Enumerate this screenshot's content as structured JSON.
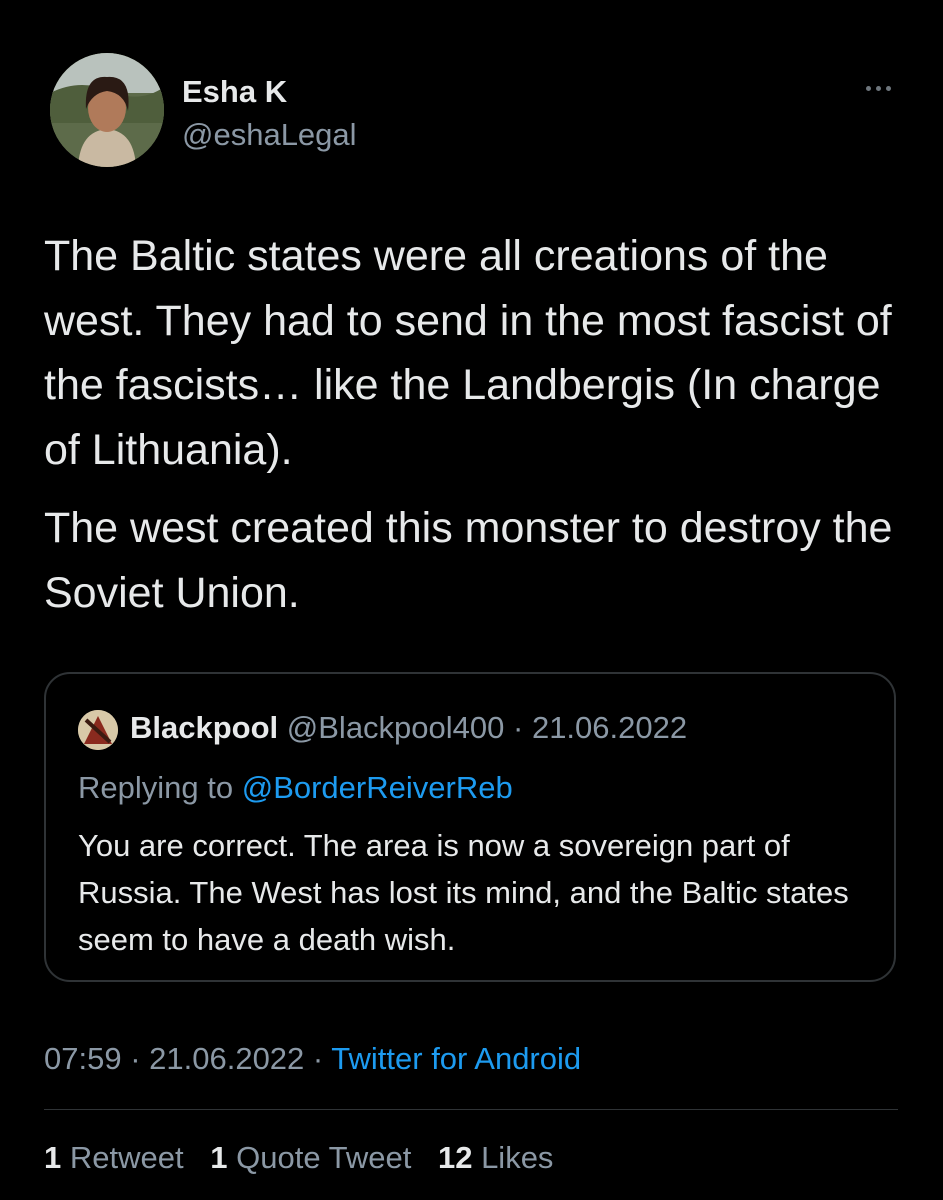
{
  "author": {
    "name": "Esha K",
    "handle": "@eshaLegal"
  },
  "tweet": {
    "paragraphs": [
      "The Baltic states were all creations of the west.  They had to send in the most fascist of the fascists… like the Landbergis (In charge of Lithuania).",
      "The west created this monster to destroy the Soviet Union."
    ]
  },
  "quote": {
    "name": "Blackpool",
    "handle": "@Blackpool400",
    "separator": " · ",
    "date": "21.06.2022",
    "replying_prefix": "Replying to ",
    "replying_to": "@BorderReiverReb",
    "text": "You are correct. The area is now a sovereign part of Russia. The West has lost its mind, and the Baltic states seem to have a death wish."
  },
  "meta": {
    "time": "07:59",
    "separator": " · ",
    "date": "21.06.2022",
    "source": "Twitter for Android"
  },
  "stats": {
    "retweets_count": "1",
    "retweets_label": "Retweet",
    "quotes_count": "1",
    "quotes_label": "Quote Tweet",
    "likes_count": "12",
    "likes_label": "Likes"
  },
  "icons": {
    "more": "more-options-icon"
  },
  "colors": {
    "background": "#000000",
    "text": "#e7e9ea",
    "secondary": "#8b98a5",
    "link": "#1d9bf0",
    "border": "#2f3336"
  }
}
